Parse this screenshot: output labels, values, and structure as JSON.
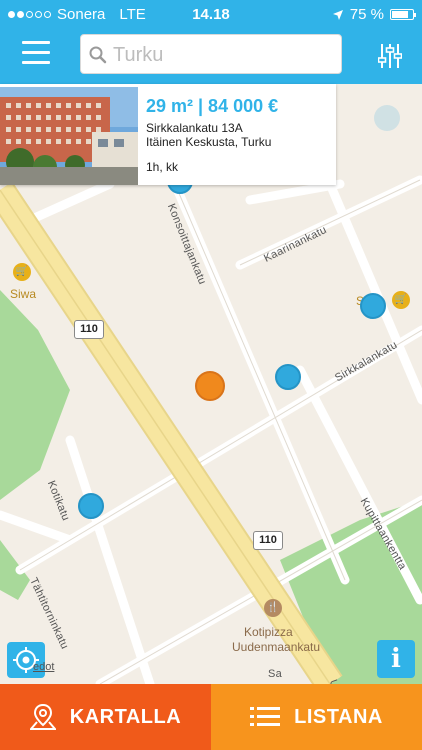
{
  "status_bar": {
    "carrier": "Sonera",
    "network": "LTE",
    "time": "14.18",
    "battery_percent": "75 %",
    "battery_level": 0.75,
    "signal_bars_filled": 2,
    "signal_bars_total": 5
  },
  "nav": {
    "search_placeholder": "Turku",
    "menu_icon": "hamburger-menu-icon",
    "filter_icon": "sliders-filter-icon"
  },
  "listing": {
    "price_line": "29 m² | 84 000 €",
    "address": "Sirkkalankatu 13A",
    "area": "Itäinen Keskusta, Turku",
    "rooms": "1h, kk"
  },
  "map": {
    "labels": {
      "siwa": "Siwa",
      "kotipizza_1": "Kotipizza",
      "kotipizza_2": "Uudenmaankatu",
      "legal": "edot"
    },
    "roads": {
      "konsoittajankatu": "Konsoittajankatu",
      "kaarinankatu": "Kaarinankatu",
      "sirkkalankatu": "Sirkkalankatu",
      "kotikatu": "Kotikatu",
      "kupittaankentta": "Kupittaankentta",
      "tahtitorninkatu": "Tähtitorninkatu",
      "u_fragment": "U",
      "s_fragment": "S",
      "sa_fragment": "Sa"
    },
    "route_shield": "110",
    "colors": {
      "marker_blue": "#30a9dd",
      "marker_selected": "#f0891d",
      "park_green": "#a8d99a",
      "main_road": "#f7e6a0"
    }
  },
  "tabs": {
    "map_label": "KARTALLA",
    "list_label": "LISTANA"
  },
  "colors": {
    "primary": "#30b3e8",
    "tab_active": "#f05a1a",
    "tab_inactive": "#f7941d"
  }
}
